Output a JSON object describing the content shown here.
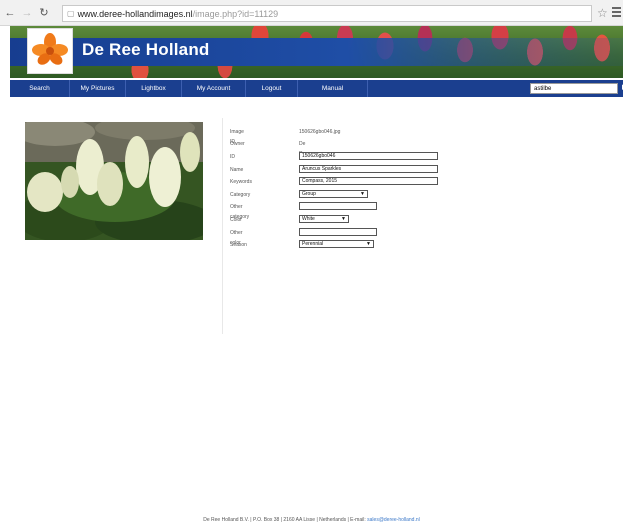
{
  "browser": {
    "url_host": "www.deree-hollandimages.nl",
    "url_path": "/image.php?id=11129"
  },
  "banner": {
    "brand": "De Ree Holland"
  },
  "nav": {
    "items": [
      "Search",
      "My Pictures",
      "Lightbox",
      "My Account",
      "Logout",
      "Manual"
    ],
    "search_value": "astilbe"
  },
  "form": {
    "image_id": {
      "label": "Image ID",
      "value": "150626gbo046.jpg"
    },
    "owner": {
      "label": "Owner",
      "value": "De Ree"
    },
    "id": {
      "label": "ID",
      "value": "150626gbo046"
    },
    "name": {
      "label": "Name",
      "value": "Aruncus Sparkles"
    },
    "keywords": {
      "label": "Keywords",
      "value": "Compass, 2015"
    },
    "category": {
      "label": "Category",
      "value": "Group"
    },
    "other_category": {
      "label": "Other category",
      "value": ""
    },
    "color": {
      "label": "Color",
      "value": "White"
    },
    "other_color": {
      "label": "Other color",
      "value": ""
    },
    "season": {
      "label": "Season",
      "value": "Perennial"
    }
  },
  "footer": {
    "text": "De Ree Holland B.V.  |  P.O. Box 38  |  2160 AA Lisse  |  Netherlands  |  E-mail:",
    "email": "sales@deree-holland.nl"
  },
  "colors": {
    "nav_bg": "#1b3f8f",
    "brand_strip": "#1f4ea6",
    "link": "#3b78c8"
  }
}
